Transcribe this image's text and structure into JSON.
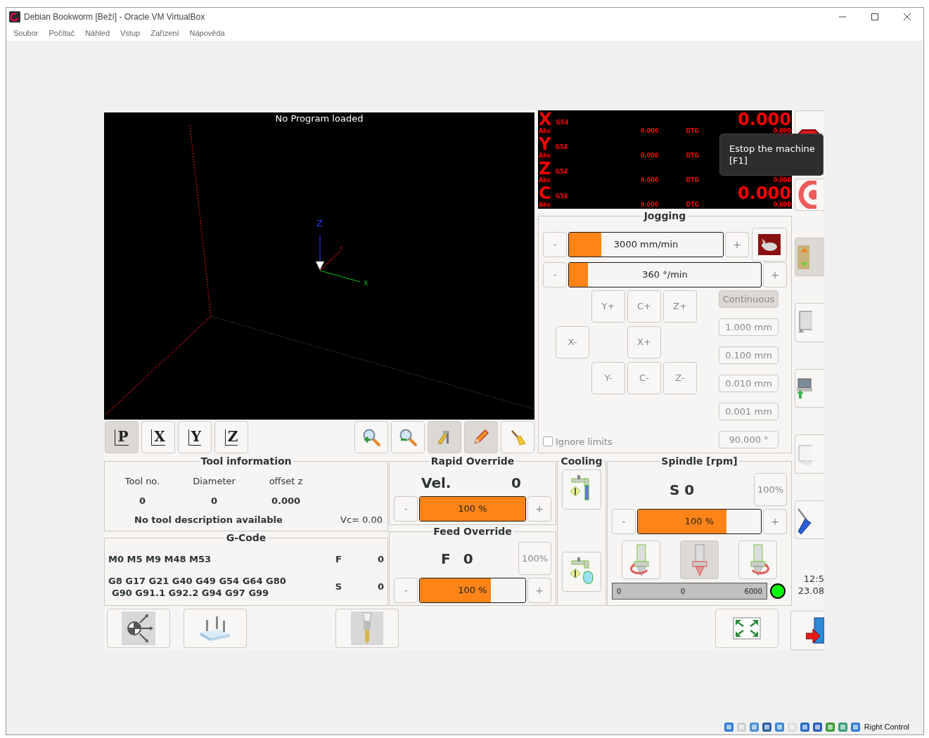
{
  "window": {
    "title": "Debian Bookworm [Beží] - Oracle VM VirtualBox"
  },
  "menu": [
    "Soubor",
    "Počítač",
    "Náhled",
    "Vstup",
    "Zařízení",
    "Nápověda"
  ],
  "preview": {
    "title": "No Program loaded",
    "axis_labels": [
      "Z",
      "Y",
      "X"
    ]
  },
  "view_buttons": [
    {
      "label": "P",
      "selected": true
    },
    {
      "label": "X",
      "selected": false
    },
    {
      "label": "Y",
      "selected": false
    },
    {
      "label": "Z",
      "selected": false
    }
  ],
  "preview_tools": [
    {
      "kind": "zoom-in",
      "selected": false
    },
    {
      "kind": "zoom-out",
      "selected": false
    },
    {
      "kind": "measure",
      "selected": true
    },
    {
      "kind": "edit",
      "selected": true
    },
    {
      "kind": "clear",
      "selected": false
    }
  ],
  "dro": [
    {
      "axis": "X",
      "offset": "G54",
      "abs_label": "Abs",
      "abs": "0.000",
      "dtg_label": "DTG",
      "dtg": "0.000",
      "value": "0.000"
    },
    {
      "axis": "Y",
      "offset": "G54",
      "abs_label": "Abs",
      "abs": "0.000",
      "dtg_label": "DTG"
    },
    {
      "axis": "Z",
      "offset": "G54",
      "abs_label": "Abs",
      "abs": "0.000",
      "dtg_label": "DTG",
      "dtg": "0.000"
    },
    {
      "axis": "C",
      "offset": "G54",
      "abs_label": "Abs",
      "abs": "0.000",
      "dtg_label": "DTG",
      "dtg": "0.000",
      "value": "0.000"
    }
  ],
  "tooltip": [
    "Estop the machine",
    "[F1]"
  ],
  "jogging": {
    "title": "Jogging",
    "speeds": [
      {
        "kind": "linear",
        "minus": "-",
        "reading": "3000 mm/min",
        "level": 0.21,
        "plus": "+"
      },
      {
        "kind": "angular",
        "minus": "-",
        "reading": "360 °/min",
        "level": 0.1,
        "plus": "+"
      }
    ],
    "jog_buttons": [
      "Y+",
      "C+",
      "Z+",
      "X-",
      "X+",
      "Y-",
      "C-",
      "Z-"
    ],
    "increments": [
      {
        "label": "Continuous",
        "selected": true
      },
      {
        "label": "1.000 mm",
        "selected": false
      },
      {
        "label": "0.100 mm",
        "selected": false
      },
      {
        "label": "0.010 mm",
        "selected": false
      },
      {
        "label": "0.001 mm",
        "selected": false
      },
      {
        "label": "90.000 °",
        "selected": false
      }
    ],
    "ignore_limits": {
      "label": "Ignore limits",
      "checked": false
    }
  },
  "tool_info": {
    "title": "Tool information",
    "columns": [
      "Tool no.",
      "Diameter",
      "offset z"
    ],
    "values": [
      "0",
      "0",
      "0.000"
    ],
    "description": "No tool description available",
    "vc": "Vc= 0.00"
  },
  "gcode": {
    "title": "G-Code",
    "m_codes": "M0 M5 M9 M48 M53",
    "g_codes": [
      "G8 G17 G21 G40 G49 G54 G64 G80",
      "G90 G91.1 G92.2 G94 G97 G99"
    ],
    "f_label": "F",
    "f_value": "0",
    "s_label": "S",
    "s_value": "0"
  },
  "rapid_override": {
    "title": "Rapid Override",
    "label": "Vel.",
    "value": "0",
    "minus": "-",
    "plus": "+",
    "reading": "100 %",
    "level": 1
  },
  "feed_override": {
    "title": "Feed Override",
    "label": "F",
    "value": "0",
    "reset": "100%",
    "minus": "-",
    "plus": "+",
    "reading": "100 %",
    "level": 0.67
  },
  "cooling": {
    "title": "Cooling",
    "buttons": [
      {
        "kind": "flood",
        "selected": false
      },
      {
        "kind": "mist",
        "selected": false
      }
    ]
  },
  "spindle": {
    "title": "Spindle [rpm]",
    "label": "S 0",
    "reset": "100%",
    "minus": "-",
    "plus": "+",
    "reading": "100 %",
    "level": 0.72,
    "direction_buttons": [
      {
        "kind": "ccw",
        "selected": false
      },
      {
        "kind": "stop",
        "selected": true
      },
      {
        "kind": "cw",
        "selected": false
      }
    ],
    "gauge": {
      "min": "0",
      "value": "0",
      "max": "6000"
    },
    "at_speed": true
  },
  "side_buttons": [
    {
      "kind": "estop"
    },
    {
      "kind": "power"
    },
    {
      "kind": "modes"
    },
    {
      "kind": "mdi"
    },
    {
      "kind": "auto"
    },
    {
      "kind": "settings"
    },
    {
      "kind": "tools"
    }
  ],
  "clock": [
    "12:5",
    "23.08"
  ],
  "bottom_buttons": [
    {
      "kind": "touch-off"
    },
    {
      "kind": "probe"
    },
    {
      "kind": "tool"
    },
    {
      "kind": "fullscreen"
    }
  ],
  "status_bar": {
    "text": "Right Control"
  }
}
